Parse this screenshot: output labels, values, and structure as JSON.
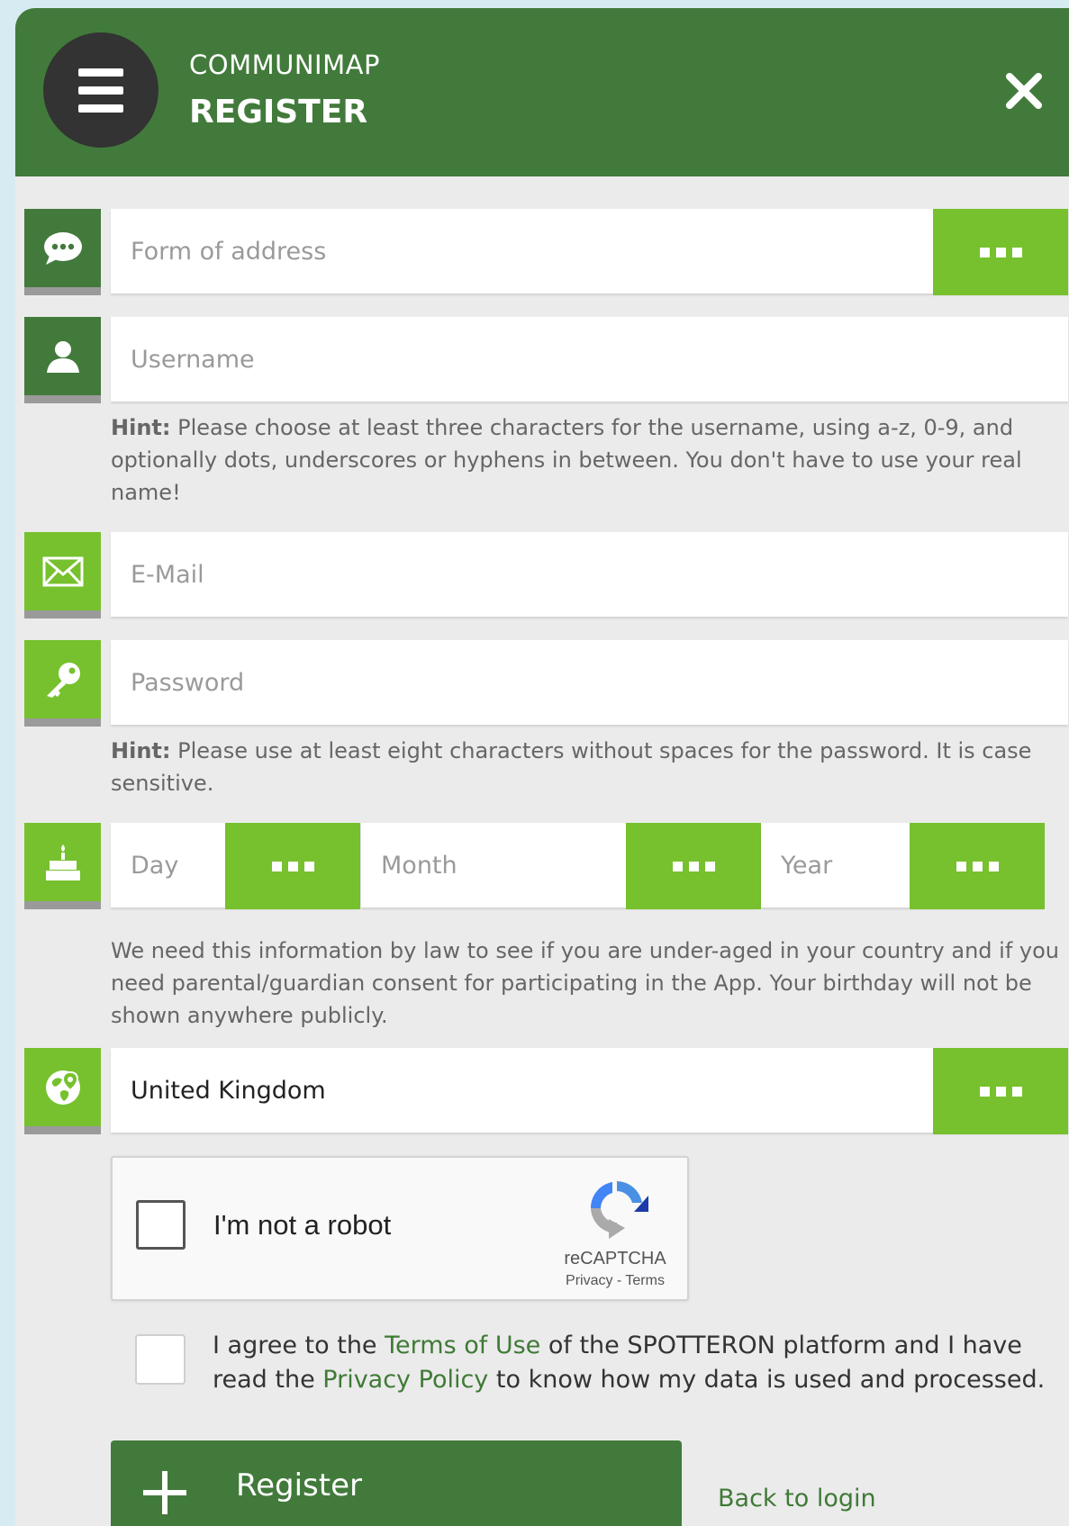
{
  "header": {
    "app_name": "COMMUNIMAP",
    "title": "REGISTER",
    "menu_icon": "hamburger-icon",
    "close_icon": "close-icon"
  },
  "fields": {
    "form_of_address": {
      "placeholder": "Form of address",
      "icon": "speech-bubble-icon"
    },
    "username": {
      "placeholder": "Username",
      "icon": "user-icon"
    },
    "email": {
      "placeholder": "E-Mail",
      "icon": "envelope-icon"
    },
    "password": {
      "placeholder": "Password",
      "icon": "key-icon"
    },
    "birthday": {
      "day_placeholder": "Day",
      "month_placeholder": "Month",
      "year_placeholder": "Year",
      "icon": "birthday-cake-icon"
    },
    "country": {
      "value": "United Kingdom",
      "icon": "globe-pin-icon"
    }
  },
  "hints": {
    "username_label": "Hint:",
    "username_text": " Please choose at least three characters for the username, using a-z, 0-9, and optionally dots, underscores or hyphens in between. You don't have to use your real name!",
    "password_label": "Hint:",
    "password_text": " Please use at least eight characters without spaces for the password. It is case sensitive.",
    "birthday_text": "We need this information by law to see if you are under-aged in your country and if you need parental/guardian consent for participating in the App. Your birthday will not be shown anywhere publicly."
  },
  "captcha": {
    "label": "I'm not a robot",
    "brand": "reCAPTCHA",
    "privacy": "Privacy",
    "separator": " - ",
    "terms": "Terms"
  },
  "agreement": {
    "part1": "I agree to the ",
    "terms_link": "Terms of Use",
    "part2": " of the SPOTTERON platform and I have read the ",
    "privacy_link": "Privacy Policy",
    "part3": " to know how my data is used and processed."
  },
  "actions": {
    "register_label": "Register",
    "back_to_login": "Back to login"
  },
  "colors": {
    "dark_green": "#427a3b",
    "light_green": "#76c12d",
    "background": "#ebebeb"
  }
}
